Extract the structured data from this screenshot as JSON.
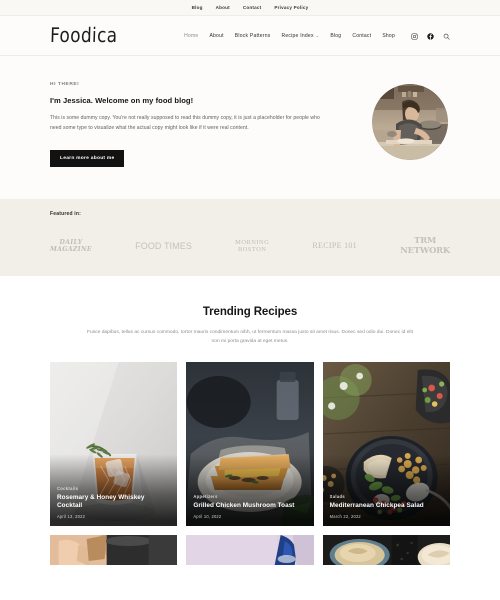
{
  "topbar": {
    "links": [
      {
        "label": "Blog"
      },
      {
        "label": "About"
      },
      {
        "label": "Contact"
      },
      {
        "label": "Privacy Policy"
      }
    ]
  },
  "header": {
    "logo": "Foodica",
    "nav": [
      {
        "label": "Home",
        "active": true
      },
      {
        "label": "About",
        "active": false
      },
      {
        "label": "Block Patterns",
        "active": false
      },
      {
        "label": "Recipe Index",
        "active": false,
        "dropdown": true
      },
      {
        "label": "Blog",
        "active": false
      },
      {
        "label": "Contact",
        "active": false
      },
      {
        "label": "Shop",
        "active": false
      }
    ],
    "caret": "⌄",
    "icons": [
      {
        "name": "instagram-icon"
      },
      {
        "name": "facebook-icon"
      },
      {
        "name": "search-icon"
      }
    ]
  },
  "hero": {
    "eyebrow": "HI THERE!",
    "title": "I'm Jessica. Welcome on my food blog!",
    "copy": "This is some dummy copy. You're not really supposed to read this dummy copy, it is just a placeholder for people who need some type to visualize what the actual copy might look like if it were real content.",
    "button": "Learn more about me",
    "photo_alt": "woman cooking in kitchen"
  },
  "featured": {
    "label": "Featured in:",
    "brands": [
      {
        "line1": "DAILY",
        "line2": "MAGAZINE"
      },
      {
        "line1": "FOOD TIMES",
        "line2": ""
      },
      {
        "line1": "MORNING",
        "line2": "BOSTON"
      },
      {
        "line1": "RECIPE 101",
        "line2": ""
      },
      {
        "line1": "TRM",
        "line2": "NETWORK"
      }
    ]
  },
  "trending": {
    "title": "Trending Recipes",
    "subtitle": "Fusce dapibus, tellus ac cursus commodo, tortor mauris condimentum nibh, ut fermentum massa justo sit amet risus. Donec sed odio dui. Donec id elit non mi porta gravida at eget metus.",
    "cards": [
      {
        "category": "Cocktails",
        "title": "Rosemary & Honey Whiskey Cocktail",
        "date": "April 13, 2022",
        "image": "cocktail-glass-rosemary"
      },
      {
        "category": "Appetizers",
        "title": "Grilled Chicken Mushroom Toast",
        "date": "April 10, 2022",
        "image": "grilled-sandwich-plate"
      },
      {
        "category": "Salads",
        "title": "Mediterranean Chickpea Salad",
        "date": "March 22, 2022",
        "image": "chickpea-salad-bowl"
      }
    ],
    "cards_row2": [
      {
        "image": "hands-stirring-pot"
      },
      {
        "image": "lavender-scene"
      },
      {
        "image": "cream-bowl-dark"
      }
    ]
  },
  "colors": {
    "page_bg": "#ffffff",
    "topbar_bg": "#faf8f5",
    "hero_bg": "#fdfcfa",
    "featured_bg": "#f2efe9",
    "text_dark": "#141414",
    "text_muted": "#8d8d8d",
    "brand_logo_gray": "#c2bdb4",
    "button_bg": "#121212"
  }
}
